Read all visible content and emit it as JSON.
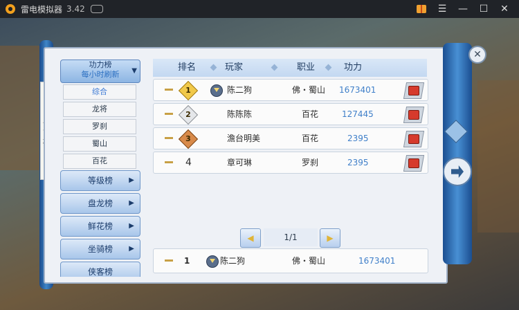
{
  "window": {
    "app_title": "雷电模拟器",
    "version": "3.42",
    "controls": [
      "gift-icon",
      "menu-icon",
      "minimize-icon",
      "maximize-icon",
      "close-icon"
    ]
  },
  "side_label": {
    "chars": [
      "风",
      "云",
      "榜"
    ]
  },
  "sidebar": {
    "header_title": "功力榜",
    "header_subtitle": "每小时刷新",
    "sub_items": [
      "综合",
      "龙将",
      "罗刹",
      "蜀山",
      "百花"
    ],
    "active_sub_index": 0,
    "categories": [
      "等级榜",
      "盘龙榜",
      "鲜花榜",
      "坐骑榜",
      "侠客榜"
    ]
  },
  "table": {
    "headers": [
      "排名",
      "玩家",
      "职业",
      "功力"
    ],
    "rows": [
      {
        "rank": "1",
        "player": "陈二狗",
        "class": "佛・蜀山",
        "power": "1673401",
        "badge": "gold",
        "vip": true
      },
      {
        "rank": "2",
        "player": "陈陈陈",
        "class": "百花",
        "power": "127445",
        "badge": "silver",
        "vip": false
      },
      {
        "rank": "3",
        "player": "澹台明美",
        "class": "百花",
        "power": "2395",
        "badge": "bronze",
        "vip": false
      },
      {
        "rank": "4",
        "player": "章可琳",
        "class": "罗刹",
        "power": "2395",
        "badge": "none",
        "vip": false
      }
    ]
  },
  "pagination": {
    "text": "1/1"
  },
  "my_rank": {
    "rank": "1",
    "player": "陈二狗",
    "class": "佛・蜀山",
    "power": "1673401"
  },
  "colors": {
    "accent": "#3f7fc9",
    "rod": "#1b4e90",
    "panel": "#eef1f6",
    "chest": "#d63a2c"
  }
}
